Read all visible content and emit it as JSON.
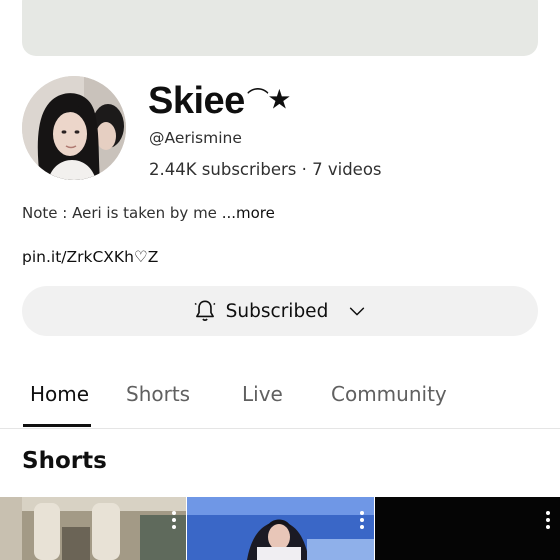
{
  "channel": {
    "name": "Skiee",
    "name_decoration": "⌒★",
    "handle": "@Aerismine",
    "stats": "2.44K subscribers · 7 videos"
  },
  "about": {
    "note": "Note : Aeri is taken by me",
    "more_label": "...more",
    "link": "pin.it/ZrkCXKh♡Z"
  },
  "subscribe": {
    "label": "Subscribed",
    "icon": "bell-icon",
    "dropdown_icon": "chevron-down-icon"
  },
  "tabs": [
    {
      "label": "Home",
      "active": true
    },
    {
      "label": "Shorts",
      "active": false
    },
    {
      "label": "Live",
      "active": false
    },
    {
      "label": "Community",
      "active": false
    }
  ],
  "shorts_section": {
    "title": "Shorts"
  },
  "colors": {
    "banner": "#e6e8e4",
    "button_bg": "#f1f1f1",
    "text_primary": "#0f0f0f",
    "text_secondary": "#606060"
  }
}
